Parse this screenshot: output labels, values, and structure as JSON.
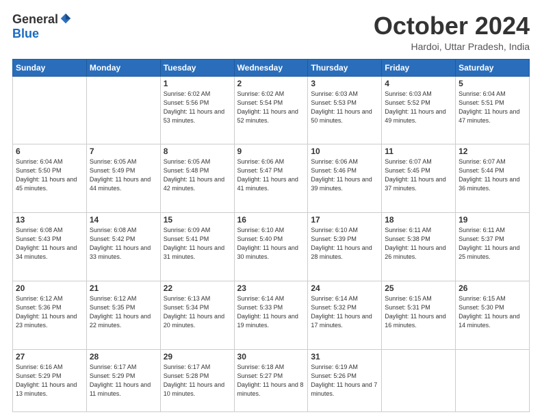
{
  "logo": {
    "general": "General",
    "blue": "Blue"
  },
  "header": {
    "month": "October 2024",
    "location": "Hardoi, Uttar Pradesh, India"
  },
  "days_of_week": [
    "Sunday",
    "Monday",
    "Tuesday",
    "Wednesday",
    "Thursday",
    "Friday",
    "Saturday"
  ],
  "weeks": [
    [
      {
        "day": "",
        "info": ""
      },
      {
        "day": "",
        "info": ""
      },
      {
        "day": "1",
        "info": "Sunrise: 6:02 AM\nSunset: 5:56 PM\nDaylight: 11 hours and 53 minutes."
      },
      {
        "day": "2",
        "info": "Sunrise: 6:02 AM\nSunset: 5:54 PM\nDaylight: 11 hours and 52 minutes."
      },
      {
        "day": "3",
        "info": "Sunrise: 6:03 AM\nSunset: 5:53 PM\nDaylight: 11 hours and 50 minutes."
      },
      {
        "day": "4",
        "info": "Sunrise: 6:03 AM\nSunset: 5:52 PM\nDaylight: 11 hours and 49 minutes."
      },
      {
        "day": "5",
        "info": "Sunrise: 6:04 AM\nSunset: 5:51 PM\nDaylight: 11 hours and 47 minutes."
      }
    ],
    [
      {
        "day": "6",
        "info": "Sunrise: 6:04 AM\nSunset: 5:50 PM\nDaylight: 11 hours and 45 minutes."
      },
      {
        "day": "7",
        "info": "Sunrise: 6:05 AM\nSunset: 5:49 PM\nDaylight: 11 hours and 44 minutes."
      },
      {
        "day": "8",
        "info": "Sunrise: 6:05 AM\nSunset: 5:48 PM\nDaylight: 11 hours and 42 minutes."
      },
      {
        "day": "9",
        "info": "Sunrise: 6:06 AM\nSunset: 5:47 PM\nDaylight: 11 hours and 41 minutes."
      },
      {
        "day": "10",
        "info": "Sunrise: 6:06 AM\nSunset: 5:46 PM\nDaylight: 11 hours and 39 minutes."
      },
      {
        "day": "11",
        "info": "Sunrise: 6:07 AM\nSunset: 5:45 PM\nDaylight: 11 hours and 37 minutes."
      },
      {
        "day": "12",
        "info": "Sunrise: 6:07 AM\nSunset: 5:44 PM\nDaylight: 11 hours and 36 minutes."
      }
    ],
    [
      {
        "day": "13",
        "info": "Sunrise: 6:08 AM\nSunset: 5:43 PM\nDaylight: 11 hours and 34 minutes."
      },
      {
        "day": "14",
        "info": "Sunrise: 6:08 AM\nSunset: 5:42 PM\nDaylight: 11 hours and 33 minutes."
      },
      {
        "day": "15",
        "info": "Sunrise: 6:09 AM\nSunset: 5:41 PM\nDaylight: 11 hours and 31 minutes."
      },
      {
        "day": "16",
        "info": "Sunrise: 6:10 AM\nSunset: 5:40 PM\nDaylight: 11 hours and 30 minutes."
      },
      {
        "day": "17",
        "info": "Sunrise: 6:10 AM\nSunset: 5:39 PM\nDaylight: 11 hours and 28 minutes."
      },
      {
        "day": "18",
        "info": "Sunrise: 6:11 AM\nSunset: 5:38 PM\nDaylight: 11 hours and 26 minutes."
      },
      {
        "day": "19",
        "info": "Sunrise: 6:11 AM\nSunset: 5:37 PM\nDaylight: 11 hours and 25 minutes."
      }
    ],
    [
      {
        "day": "20",
        "info": "Sunrise: 6:12 AM\nSunset: 5:36 PM\nDaylight: 11 hours and 23 minutes."
      },
      {
        "day": "21",
        "info": "Sunrise: 6:12 AM\nSunset: 5:35 PM\nDaylight: 11 hours and 22 minutes."
      },
      {
        "day": "22",
        "info": "Sunrise: 6:13 AM\nSunset: 5:34 PM\nDaylight: 11 hours and 20 minutes."
      },
      {
        "day": "23",
        "info": "Sunrise: 6:14 AM\nSunset: 5:33 PM\nDaylight: 11 hours and 19 minutes."
      },
      {
        "day": "24",
        "info": "Sunrise: 6:14 AM\nSunset: 5:32 PM\nDaylight: 11 hours and 17 minutes."
      },
      {
        "day": "25",
        "info": "Sunrise: 6:15 AM\nSunset: 5:31 PM\nDaylight: 11 hours and 16 minutes."
      },
      {
        "day": "26",
        "info": "Sunrise: 6:15 AM\nSunset: 5:30 PM\nDaylight: 11 hours and 14 minutes."
      }
    ],
    [
      {
        "day": "27",
        "info": "Sunrise: 6:16 AM\nSunset: 5:29 PM\nDaylight: 11 hours and 13 minutes."
      },
      {
        "day": "28",
        "info": "Sunrise: 6:17 AM\nSunset: 5:29 PM\nDaylight: 11 hours and 11 minutes."
      },
      {
        "day": "29",
        "info": "Sunrise: 6:17 AM\nSunset: 5:28 PM\nDaylight: 11 hours and 10 minutes."
      },
      {
        "day": "30",
        "info": "Sunrise: 6:18 AM\nSunset: 5:27 PM\nDaylight: 11 hours and 8 minutes."
      },
      {
        "day": "31",
        "info": "Sunrise: 6:19 AM\nSunset: 5:26 PM\nDaylight: 11 hours and 7 minutes."
      },
      {
        "day": "",
        "info": ""
      },
      {
        "day": "",
        "info": ""
      }
    ]
  ]
}
